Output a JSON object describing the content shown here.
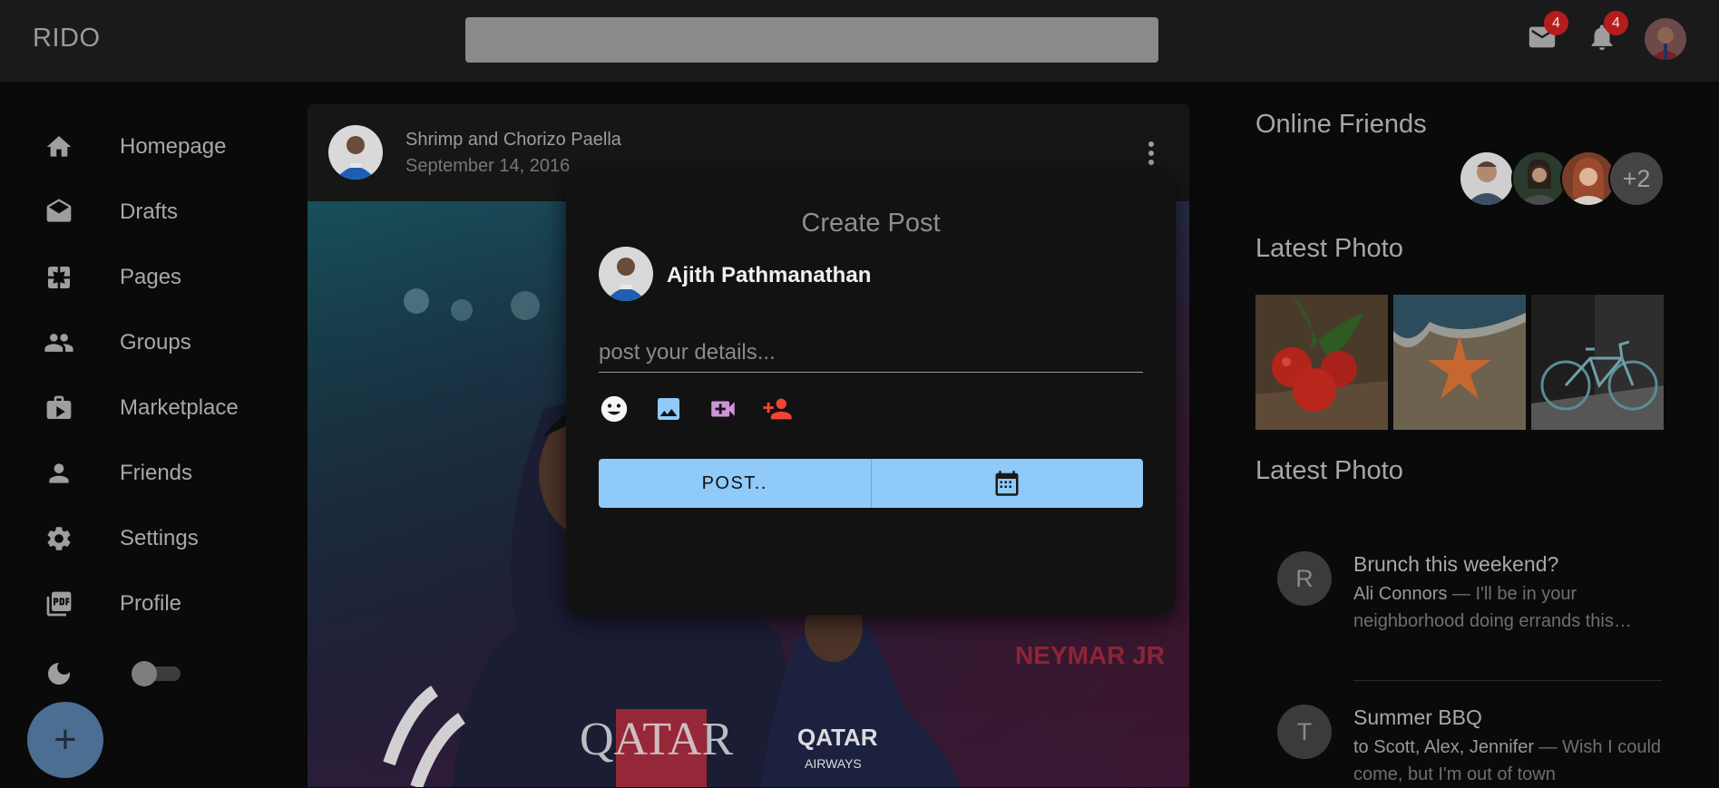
{
  "app": {
    "brand": "RIDO"
  },
  "header": {
    "search_placeholder": "",
    "mail_badge": "4",
    "notifications_badge": "4"
  },
  "sidebar": {
    "items": [
      {
        "label": "Homepage",
        "icon": "home-icon"
      },
      {
        "label": "Drafts",
        "icon": "drafts-icon"
      },
      {
        "label": "Pages",
        "icon": "pages-icon"
      },
      {
        "label": "Groups",
        "icon": "groups-icon"
      },
      {
        "label": "Marketplace",
        "icon": "storefront-icon"
      },
      {
        "label": "Friends",
        "icon": "person-icon"
      },
      {
        "label": "Settings",
        "icon": "gear-icon"
      },
      {
        "label": "Profile",
        "icon": "pdf-icon"
      }
    ],
    "dark_mode_on": false,
    "fab_label": "+"
  },
  "post": {
    "title": "Shrimp and Chorizo Paella",
    "date": "September 14, 2016"
  },
  "modal": {
    "title": "Create Post",
    "user_name": "Ajith Pathmanathan",
    "input_placeholder": "post your details...",
    "post_button": "POST..",
    "icons": [
      "emoji-icon",
      "image-icon",
      "video-icon",
      "person-add-icon",
      "calendar-icon"
    ]
  },
  "right": {
    "online_title": "Online Friends",
    "online_more": "+2",
    "photos_title": "Latest Photo",
    "messages_title": "Latest Photo",
    "messages": [
      {
        "initial": "R",
        "title": "Brunch this weekend?",
        "sender": "Ali Connors",
        "preview": " — I'll be in your neighborhood doing errands this…"
      },
      {
        "initial": "T",
        "title": "Summer BBQ",
        "sender": "to Scott, Alex, Jennifer",
        "preview": " — Wish I could come, but I'm out of town"
      }
    ]
  },
  "colors": {
    "background": "#0a0a0a",
    "topbar": "#1a1a1a",
    "accent": "#90caf9",
    "badge": "#b71c1c",
    "add_person": "#f44336",
    "video": "#ce93d8"
  }
}
